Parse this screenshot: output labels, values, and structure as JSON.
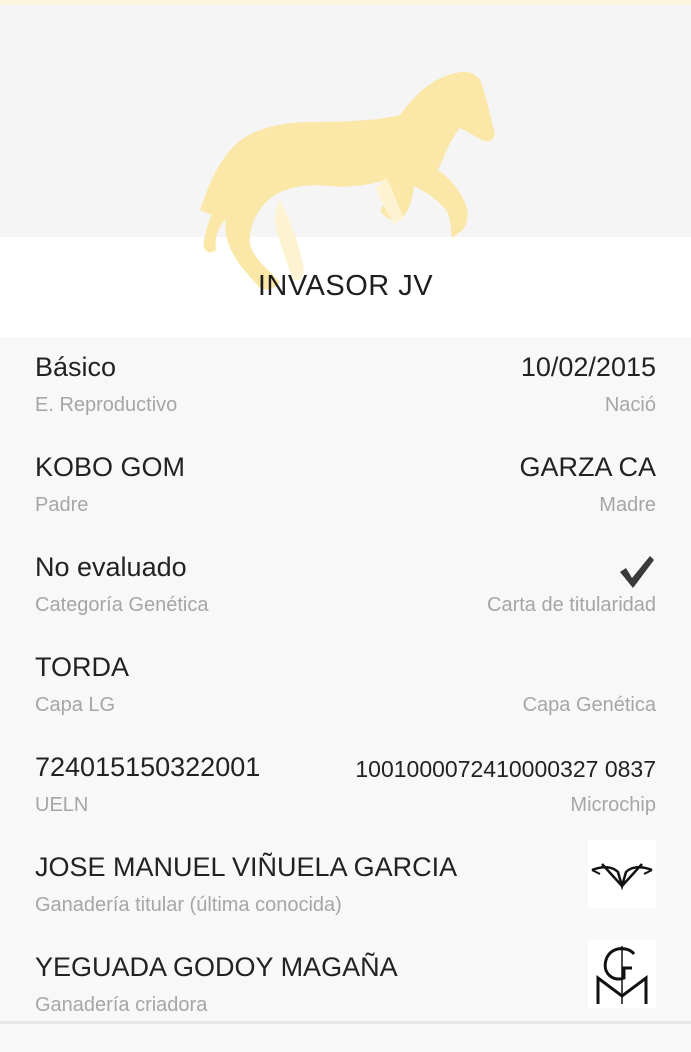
{
  "colors": {
    "accent": "#fbe7a8",
    "value_text": "#222222",
    "label_text": "#a6a6a6"
  },
  "header": {
    "horse_name": "INVASOR JV",
    "image_icon": "horse-silhouette-icon"
  },
  "fields": [
    {
      "left_value": "Básico",
      "left_label": "E. Reproductivo",
      "right_value": "10/02/2015",
      "right_label": "Nació"
    },
    {
      "left_value": "KOBO GOM",
      "left_label": "Padre",
      "right_value": "GARZA CA",
      "right_label": "Madre"
    },
    {
      "left_value": "No evaluado",
      "left_label": "Categoría Genética",
      "right_icon": "checkmark-icon",
      "right_label": "Carta de titularidad"
    },
    {
      "left_value": "TORDA",
      "left_label": "Capa LG",
      "right_value": "",
      "right_label": "Capa Genética"
    },
    {
      "left_value": "724015150322001",
      "left_label": "UELN",
      "right_value": "1001000072410000327 0837",
      "right_label": "Microchip"
    },
    {
      "left_value": "JOSE MANUEL VIÑUELA GARCIA",
      "left_label": "Ganadería titular (última conocida)",
      "right_icon": "ganaderia-titular-logo"
    },
    {
      "left_value": "YEGUADA GODOY MAGAÑA",
      "left_label": "Ganadería criadora",
      "right_icon": "ganaderia-criadora-logo"
    }
  ]
}
